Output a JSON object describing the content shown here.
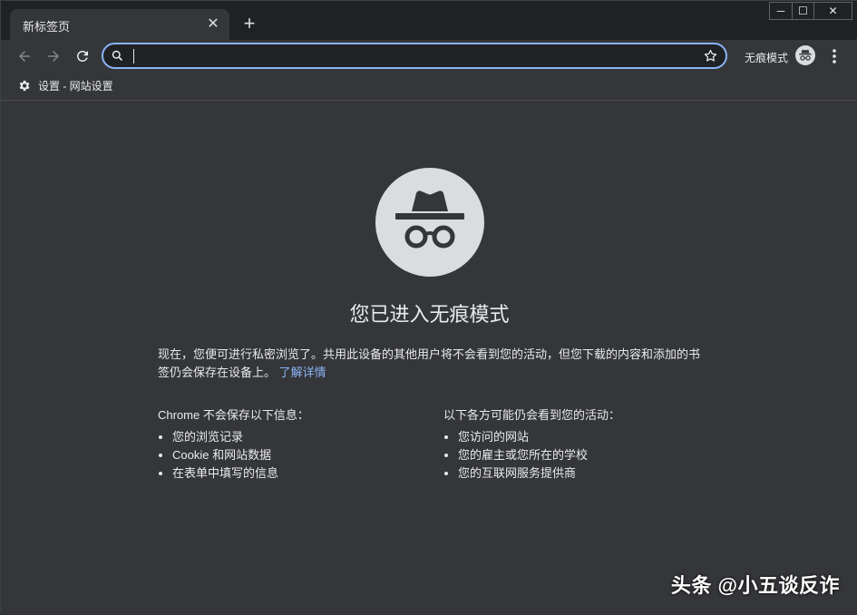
{
  "tab": {
    "title": "新标签页"
  },
  "window_controls": {
    "minimize": "─",
    "maximize": "☐",
    "close": "✕"
  },
  "toolbar": {
    "incognito_label": "无痕模式"
  },
  "omnibox": {
    "value": "",
    "placeholder": ""
  },
  "bookmarks": [
    {
      "label": "设置 - 网站设置"
    }
  ],
  "main": {
    "heading": "您已进入无痕模式",
    "intro_text": "现在，您便可进行私密浏览了。共用此设备的其他用户将不会看到您的活动，但您下载的内容和添加的书签仍会保存在设备上。",
    "learn_more": "了解详情",
    "left": {
      "title": "Chrome 不会保存以下信息：",
      "items": [
        "您的浏览记录",
        "Cookie 和网站数据",
        "在表单中填写的信息"
      ]
    },
    "right": {
      "title": "以下各方可能仍会看到您的活动：",
      "items": [
        "您访问的网站",
        "您的雇主或您所在的学校",
        "您的互联网服务提供商"
      ]
    }
  },
  "watermark": "头条 @小五谈反诈",
  "colors": {
    "background": "#35363a",
    "accent": "#8ab4f8",
    "icon_circle": "#dadce0"
  }
}
